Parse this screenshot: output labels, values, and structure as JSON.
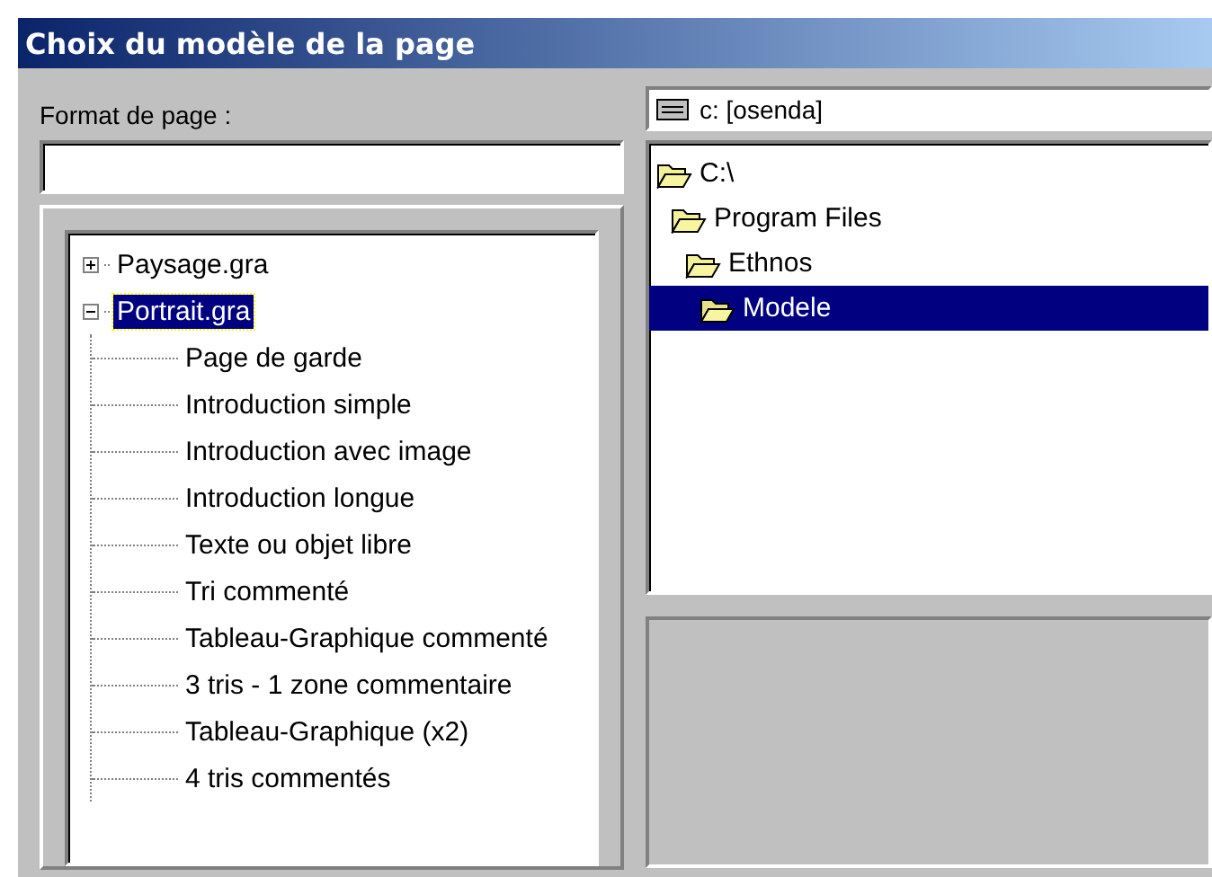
{
  "window": {
    "title": "Choix du modèle de la page"
  },
  "format_field": {
    "label": "Format de page :"
  },
  "tree": {
    "items": [
      {
        "label": "Paysage.gra",
        "expanded": false,
        "selected": false
      },
      {
        "label": "Portrait.gra",
        "expanded": true,
        "selected": true,
        "children": [
          {
            "label": "Page de garde",
            "selected": false
          },
          {
            "label": "Introduction simple",
            "selected": false
          },
          {
            "label": "Introduction avec image",
            "selected": false
          },
          {
            "label": "Introduction longue",
            "selected": false
          },
          {
            "label": "Texte ou objet libre",
            "selected": false
          },
          {
            "label": "Tri commenté",
            "selected": false
          },
          {
            "label": "Tableau-Graphique commenté",
            "selected": false
          },
          {
            "label": "3 tris - 1 zone commentaire",
            "selected": false
          },
          {
            "label": "Tableau-Graphique (x2)",
            "selected": false
          },
          {
            "label": "4 tris commentés",
            "selected": false
          }
        ]
      }
    ]
  },
  "drive": {
    "value": "c: [osenda]"
  },
  "folders": [
    {
      "label": "C:\\",
      "selected": false,
      "children": [
        {
          "label": "Program Files",
          "selected": false,
          "children": [
            {
              "label": "Ethnos",
              "selected": false,
              "children": [
                {
                  "label": "Modele",
                  "selected": true
                }
              ]
            }
          ]
        }
      ]
    }
  ]
}
